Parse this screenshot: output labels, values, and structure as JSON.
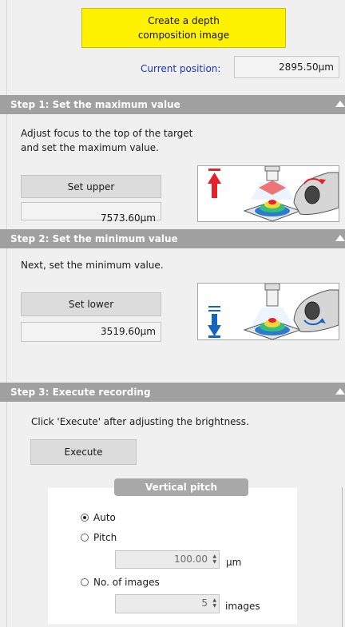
{
  "top": {
    "create_button": [
      "Create a depth",
      "composition image"
    ],
    "current_position_label": "Current position:",
    "current_position_value": "2895.50μm"
  },
  "step1": {
    "title": "Step 1: Set the maximum value",
    "description": [
      "Adjust focus to the top of the target",
      "and set the maximum value."
    ],
    "button_label": "Set upper",
    "value": "7573.60μm"
  },
  "step2": {
    "title": "Step 2: Set the minimum value",
    "description": "Next, set the minimum value.",
    "button_label": "Set lower",
    "value": "3519.60μm"
  },
  "step3": {
    "title": "Step 3: Execute recording",
    "description": "Click 'Execute' after adjusting the brightness.",
    "button_label": "Execute"
  },
  "vertical_pitch": {
    "title": "Vertical pitch",
    "options": {
      "auto": "Auto",
      "pitch": "Pitch",
      "images": "No. of images"
    },
    "selected": "auto",
    "pitch_value": "100.00",
    "pitch_unit": "μm",
    "images_value": "5",
    "images_unit": "images"
  },
  "colors": {
    "create_button_bg": "#fff200",
    "step_header_bg": "#a0a0a0",
    "current_label": "#1a32c8",
    "upper_arrow": "#e8202a",
    "lower_arrow": "#1565c0"
  }
}
